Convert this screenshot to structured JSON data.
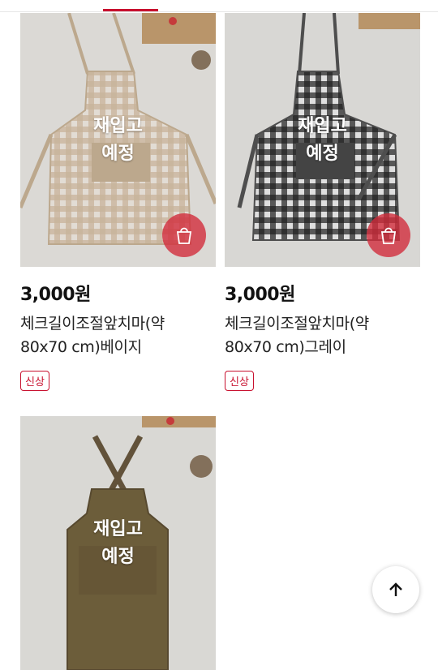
{
  "products": [
    {
      "status_overlay": "재입고\n예정",
      "price": "3,000원",
      "name": "체크길이조절앞치마(약80x70 cm)베이지",
      "badge": "신상",
      "image_icon": "beige-gingham-apron-photo"
    },
    {
      "status_overlay": "재입고\n예정",
      "price": "3,000원",
      "name": "체크길이조절앞치마(약80x70 cm)그레이",
      "badge": "신상",
      "image_icon": "black-gingham-apron-photo"
    },
    {
      "status_overlay": "재입고\n예정",
      "image_icon": "brown-cross-back-apron-photo"
    }
  ],
  "controls": {
    "cart_icon": "shopping-bag-icon",
    "scroll_top_icon": "arrow-up-icon"
  },
  "colors": {
    "accent": "#c8102e",
    "cart_button": "#d22d3c"
  }
}
